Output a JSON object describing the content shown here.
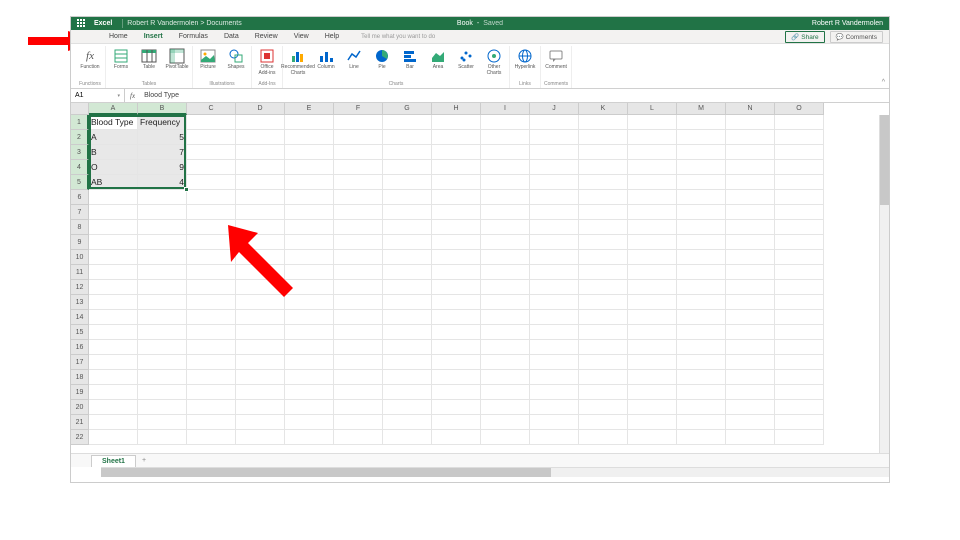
{
  "titlebar": {
    "app_name": "Excel",
    "breadcrumb": "Robert R Vandermolen > Documents",
    "doc_name": "Book",
    "status": "Saved",
    "user": "Robert R Vandermolen"
  },
  "tabs": [
    "Home",
    "Insert",
    "Formulas",
    "Data",
    "Review",
    "View",
    "Help"
  ],
  "active_tab": "Insert",
  "tell_me": "Tell me what you want to do",
  "share": "Share",
  "comments": "Comments",
  "ribbon_groups": [
    {
      "label": "Functions",
      "items": [
        {
          "icon": "fx",
          "label": "Function"
        }
      ]
    },
    {
      "label": "Tables",
      "items": [
        {
          "icon": "forms",
          "label": "Forms"
        },
        {
          "icon": "table",
          "label": "Table"
        },
        {
          "icon": "pivot",
          "label": "PivotTable"
        }
      ]
    },
    {
      "label": "Illustrations",
      "items": [
        {
          "icon": "picture",
          "label": "Picture"
        },
        {
          "icon": "shapes",
          "label": "Shapes"
        }
      ]
    },
    {
      "label": "Add-Ins",
      "items": [
        {
          "icon": "addins",
          "label": "Office Add-ins"
        }
      ]
    },
    {
      "label": "Charts",
      "items": [
        {
          "icon": "reccharts",
          "label": "Recommended Charts"
        },
        {
          "icon": "column",
          "label": "Column"
        },
        {
          "icon": "line",
          "label": "Line"
        },
        {
          "icon": "pie",
          "label": "Pie"
        },
        {
          "icon": "bar",
          "label": "Bar"
        },
        {
          "icon": "area",
          "label": "Area"
        },
        {
          "icon": "scatter",
          "label": "Scatter"
        },
        {
          "icon": "other",
          "label": "Other Charts"
        }
      ]
    },
    {
      "label": "Links",
      "items": [
        {
          "icon": "hyperlink",
          "label": "Hyperlink"
        }
      ]
    },
    {
      "label": "Comments",
      "items": [
        {
          "icon": "comment",
          "label": "Comment"
        }
      ]
    }
  ],
  "name_box": "A1",
  "formula_value": "Blood Type",
  "columns": [
    "A",
    "B",
    "C",
    "D",
    "E",
    "F",
    "G",
    "H",
    "I",
    "J",
    "K",
    "L",
    "M",
    "N",
    "O"
  ],
  "row_count": 22,
  "selected_cols": [
    "A",
    "B"
  ],
  "selected_rows": [
    1,
    2,
    3,
    4,
    5
  ],
  "data": {
    "A1": "Blood Type",
    "B1": "Frequency",
    "A2": "A",
    "B2": "5",
    "A3": "B",
    "B3": "7",
    "A4": "O",
    "B4": "9",
    "A5": "AB",
    "B5": "4"
  },
  "numeric_cells": [
    "B2",
    "B3",
    "B4",
    "B5"
  ],
  "sheet_name": "Sheet1",
  "colors": {
    "brand": "#217346",
    "arrow": "#ff0000"
  }
}
